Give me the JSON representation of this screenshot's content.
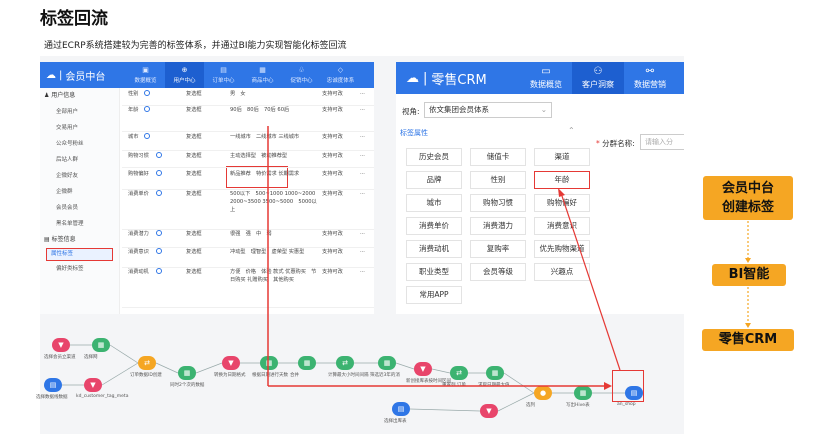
{
  "title": "标签回流",
  "subtitle": "通过ECRP系统搭建较为完善的标签体系，并通过BI能力实现智能化标签回流",
  "left_app": {
    "logo": "会员中台",
    "nav": [
      {
        "icon": "▣",
        "label": "数据概览"
      },
      {
        "icon": "⊕",
        "label": "用户中心"
      },
      {
        "icon": "▤",
        "label": "订单中心"
      },
      {
        "icon": "▦",
        "label": "商品中心"
      },
      {
        "icon": "♧",
        "label": "促销中心"
      },
      {
        "icon": "◇",
        "label": "忠诚度体系"
      }
    ],
    "sidebar": {
      "group1": "用户信息",
      "items1": [
        "全部用户",
        "交易用户",
        "公众号粉丝",
        "后站人群",
        "企微好友",
        "企微群",
        "会员会员",
        "黑名单管理"
      ],
      "group2": "标签信息",
      "selected": "属性标签",
      "more": "偏好类标签"
    },
    "rows": [
      {
        "name": "性别",
        "type": "复选框",
        "opts": "男　女",
        "status": "支持可改",
        "act": "..."
      },
      {
        "name": "年龄",
        "type": "复选框",
        "opts": "90后　80后　70后 60后",
        "status": "支持可改",
        "act": "..."
      },
      {
        "name": "城市",
        "type": "复选框",
        "opts": "一线城市　二线城市 三线城市",
        "status": "支持可改",
        "act": "..."
      },
      {
        "name": "购物习惯",
        "type": "复选框",
        "opts": "主动选择型　被动推荐型",
        "status": "支持可改",
        "act": "..."
      },
      {
        "name": "购物偏好",
        "type": "复选框",
        "opts": "新品推荐　特价需求 长期需求",
        "status": "支持可改",
        "act": "..."
      },
      {
        "name": "消费单价",
        "type": "复选框",
        "opts": "500以下　500~1000 1000~2000　2000~3500 3500~5000　5000以上",
        "status": "支持可改",
        "act": "..."
      },
      {
        "name": "消费潜力",
        "type": "复选框",
        "opts": "很强　强　中　弱",
        "status": "支持可改",
        "act": "..."
      },
      {
        "name": "消费意识",
        "type": "复选框",
        "opts": "冲动型　理智型　虚荣型 实惠型",
        "status": "支持可改",
        "act": "..."
      },
      {
        "name": "消费动机",
        "type": "复选框",
        "opts": "方便　价格　体验 款式 优惠购买　节日购买 礼赠购买　其他购买",
        "status": "支持可改",
        "act": "..."
      }
    ]
  },
  "right_app": {
    "logo": "零售CRM",
    "nav": [
      {
        "icon": "▭",
        "label": "数据概览"
      },
      {
        "icon": "⚇",
        "label": "客户洞察"
      },
      {
        "icon": "⚯",
        "label": "数据营销"
      }
    ],
    "view_label": "视角:",
    "view_value": "依文集团会员体系",
    "section": "标签属性",
    "tags": [
      "历史会员",
      "储值卡",
      "渠道",
      "品牌",
      "性别",
      "年龄",
      "城市",
      "购物习惯",
      "购物偏好",
      "消费单价",
      "消费潜力",
      "消费意识",
      "消费动机",
      "复购率",
      "优先购物渠道",
      "职业类型",
      "会员等级",
      "兴趣点",
      "常用APP"
    ],
    "fenqu_label": "分群名称:",
    "fenqu_placeholder": "请输入分"
  },
  "side_boxes": [
    "会员中台\n创建标签",
    "BI智能",
    "零售CRM"
  ],
  "flow": {
    "labels": [
      "选择会员立渠道",
      "选择网",
      "订单数据ID创建",
      "同时2个次的数据",
      "转换为日期格式",
      "根据日期进行天数",
      "合并",
      "计算最大小时间间隔",
      "筛选近3年的消",
      "新创接库表按时间区间",
      "重置列 订单",
      "求取日期最大值",
      "选列",
      "写出Hive表",
      "an_shop",
      "选择数据线数据",
      "kd_customer_tag_meta",
      "选择出库表"
    ]
  },
  "colors": {
    "blue": "#2f76e6",
    "red": "#e53935",
    "orange": "#f5a623",
    "green": "#3cb371",
    "pink": "#e8456b"
  }
}
